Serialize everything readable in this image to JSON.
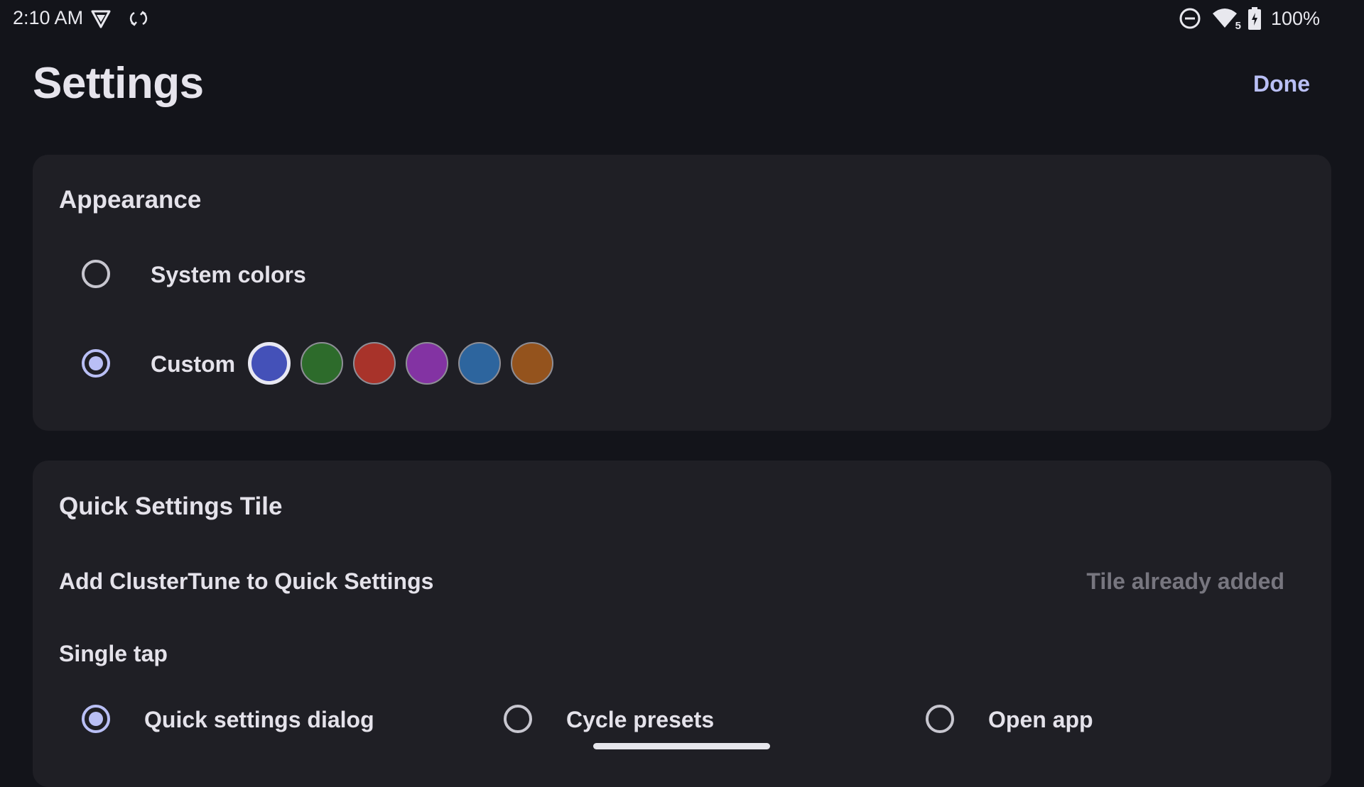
{
  "status_bar": {
    "time": "2:10 AM",
    "left_icons": [
      "vpn-shield-icon",
      "sync-icon"
    ],
    "right_icons": [
      "do-not-disturb-icon",
      "wifi-icon",
      "battery-charging-icon"
    ],
    "wifi_badge": "5",
    "battery": "100%"
  },
  "header": {
    "title": "Settings",
    "done_label": "Done"
  },
  "appearance": {
    "title": "Appearance",
    "options": [
      {
        "label": "System colors",
        "selected": false
      },
      {
        "label": "Custom",
        "selected": true
      }
    ],
    "swatches": [
      {
        "color": "#4451b8",
        "selected": true
      },
      {
        "color": "#2d6b2b",
        "selected": false
      },
      {
        "color": "#a8332a",
        "selected": false
      },
      {
        "color": "#8333a3",
        "selected": false
      },
      {
        "color": "#2d659e",
        "selected": false
      },
      {
        "color": "#94531d",
        "selected": false
      }
    ]
  },
  "quick_settings": {
    "title": "Quick Settings Tile",
    "add_label": "Add ClusterTune to Quick Settings",
    "add_status": "Tile already added",
    "single_tap_label": "Single tap",
    "tap_options": [
      {
        "label": "Quick settings dialog",
        "selected": true
      },
      {
        "label": "Cycle presets",
        "selected": false
      },
      {
        "label": "Open app",
        "selected": false
      }
    ]
  },
  "colors": {
    "background": "#13141a",
    "card": "#1f1f25",
    "accent": "#b9bff5"
  }
}
